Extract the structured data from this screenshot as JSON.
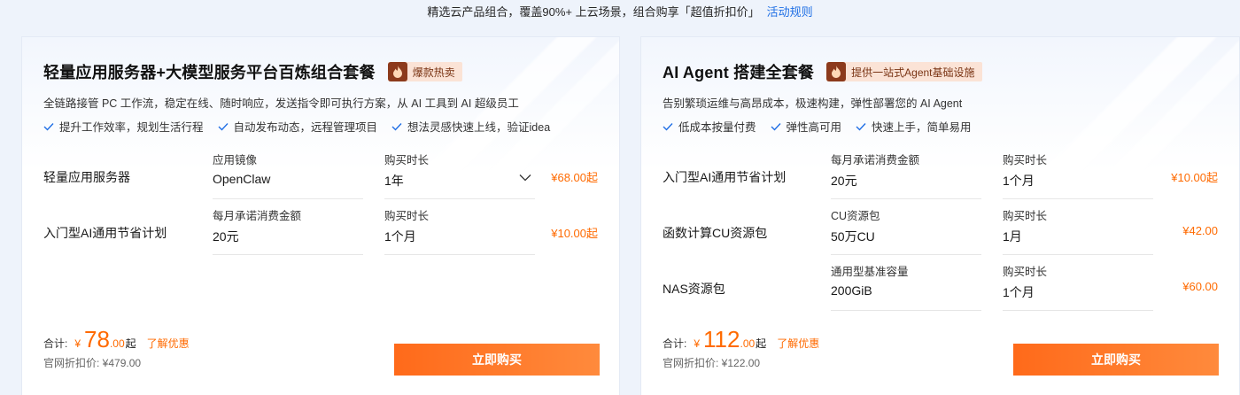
{
  "banner": {
    "text": "精选云产品组合，覆盖90%+ 上云场景，组合购享「超值折扣价」",
    "link": "活动规则"
  },
  "cards": [
    {
      "title": "轻量应用服务器+大模型服务平台百炼组合套餐",
      "tag": "爆款热卖",
      "subtitle": "全链路接管 PC 工作流，稳定在线、随时响应，发送指令即可执行方案，从 AI 工具到 AI 超级员工",
      "features": [
        "提升工作效率，规划生活行程",
        "自动发布动态，远程管理项目",
        "想法灵感快速上线，验证idea"
      ],
      "products": [
        {
          "name": "轻量应用服务器",
          "field1_label": "应用镜像",
          "field1_value": "OpenClaw",
          "field2_label": "购买时长",
          "field2_value": "1年",
          "price": "¥68.00起"
        },
        {
          "name": "入门型AI通用节省计划",
          "field1_label": "每月承诺消费金额",
          "field1_value": "20元",
          "field2_label": "购买时长",
          "field2_value": "1个月",
          "price": "¥10.00起"
        }
      ],
      "total_label": "合计:",
      "currency": "¥",
      "total_int": "78",
      "total_dec": ".00",
      "total_suffix": "起",
      "learn_more": "了解优惠",
      "official_price": "官网折扣价: ¥479.00",
      "buy_label": "立即购买"
    },
    {
      "title": "AI Agent 搭建全套餐",
      "tag": "提供一站式Agent基础设施",
      "subtitle": "告别繁琐运维与高昂成本，极速构建，弹性部署您的 AI Agent",
      "features": [
        "低成本按量付费",
        "弹性高可用",
        "快速上手，简单易用"
      ],
      "products": [
        {
          "name": "入门型AI通用节省计划",
          "field1_label": "每月承诺消费金额",
          "field1_value": "20元",
          "field2_label": "购买时长",
          "field2_value": "1个月",
          "price": "¥10.00起"
        },
        {
          "name": "函数计算CU资源包",
          "field1_label": "CU资源包",
          "field1_value": "50万CU",
          "field2_label": "购买时长",
          "field2_value": "1月",
          "price": "¥42.00"
        },
        {
          "name": "NAS资源包",
          "field1_label": "通用型基准容量",
          "field1_value": "200GiB",
          "field2_label": "购买时长",
          "field2_value": "1个月",
          "price": "¥60.00"
        }
      ],
      "total_label": "合计:",
      "currency": "¥",
      "total_int": "112",
      "total_dec": ".00",
      "total_suffix": "起",
      "learn_more": "了解优惠",
      "official_price": "官网折扣价: ¥122.00",
      "buy_label": "立即购买"
    }
  ],
  "icons": {
    "tag": "flame-icon",
    "feature": "check-icon",
    "dropdown": "chevron-down-icon"
  },
  "colors": {
    "accent": "#ff6a00",
    "link": "#1f6fe5",
    "check": "#1f6fe5",
    "tag_bg": "#fbe3d6",
    "flame_bg": "#8c3a1c"
  }
}
